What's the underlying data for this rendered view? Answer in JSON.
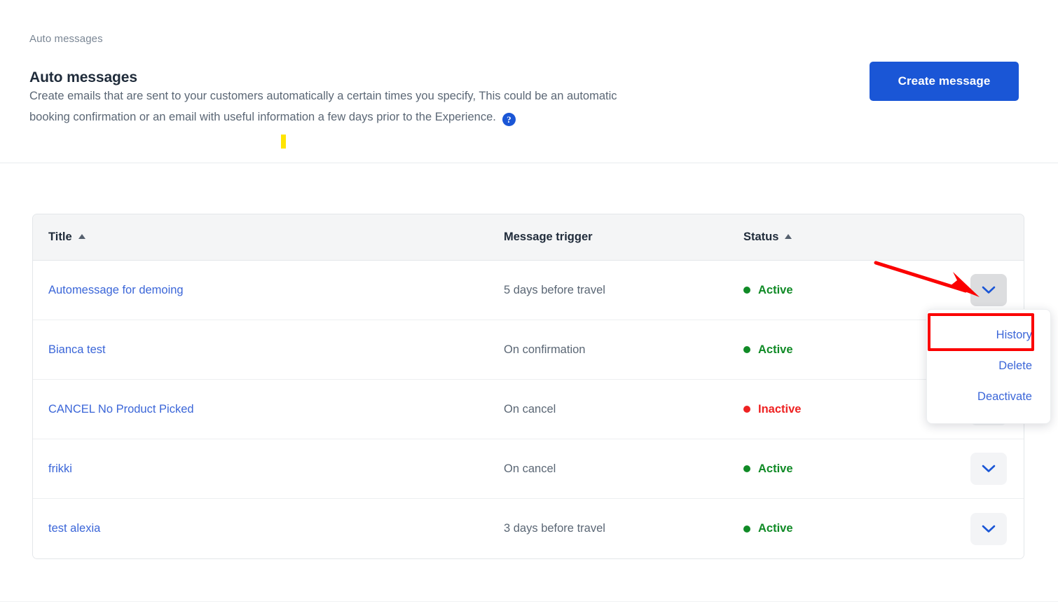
{
  "header": {
    "breadcrumb": "Auto messages",
    "title": "Auto messages",
    "description_line_1": "Create emails that are sent to your customers automatically a certain times you specify, This could be an automatic",
    "description_line_2": "booking confirmation or an email with useful information a few days prior to the Experience.",
    "help_icon_glyph": "?",
    "create_button_label": "Create message"
  },
  "table": {
    "columns": [
      {
        "label": "Title",
        "sorted": true,
        "sort_direction": "asc"
      },
      {
        "label": "Message trigger",
        "sorted": false,
        "sort_direction": ""
      },
      {
        "label": "Status",
        "sorted": true,
        "sort_direction": "asc"
      }
    ],
    "rows": [
      {
        "title": "Automessage for demoing",
        "trigger": "5 days before travel",
        "status": "Active",
        "status_state": "active",
        "menu_open": true
      },
      {
        "title": "Bianca test",
        "trigger": "On confirmation",
        "status": "Active",
        "status_state": "active",
        "menu_open": false
      },
      {
        "title": "CANCEL No Product Picked",
        "trigger": "On cancel",
        "status": "Inactive",
        "status_state": "inactive",
        "menu_open": false
      },
      {
        "title": "frikki",
        "trigger": "On cancel",
        "status": "Active",
        "status_state": "active",
        "menu_open": false
      },
      {
        "title": "test alexia",
        "trigger": "3 days before travel",
        "status": "Active",
        "status_state": "active",
        "menu_open": false
      }
    ]
  },
  "dropdown": {
    "items": [
      {
        "label": "History"
      },
      {
        "label": "Delete"
      },
      {
        "label": "Deactivate"
      }
    ]
  },
  "colors": {
    "brand_blue": "#1a56d6",
    "link_blue": "#3b66d8",
    "status_active_green": "#108a26",
    "status_inactive_red": "#ee2222",
    "annotation_red": "#fb0000",
    "caret_yellow": "#ffe400",
    "header_bg_gray": "#f4f5f6"
  }
}
